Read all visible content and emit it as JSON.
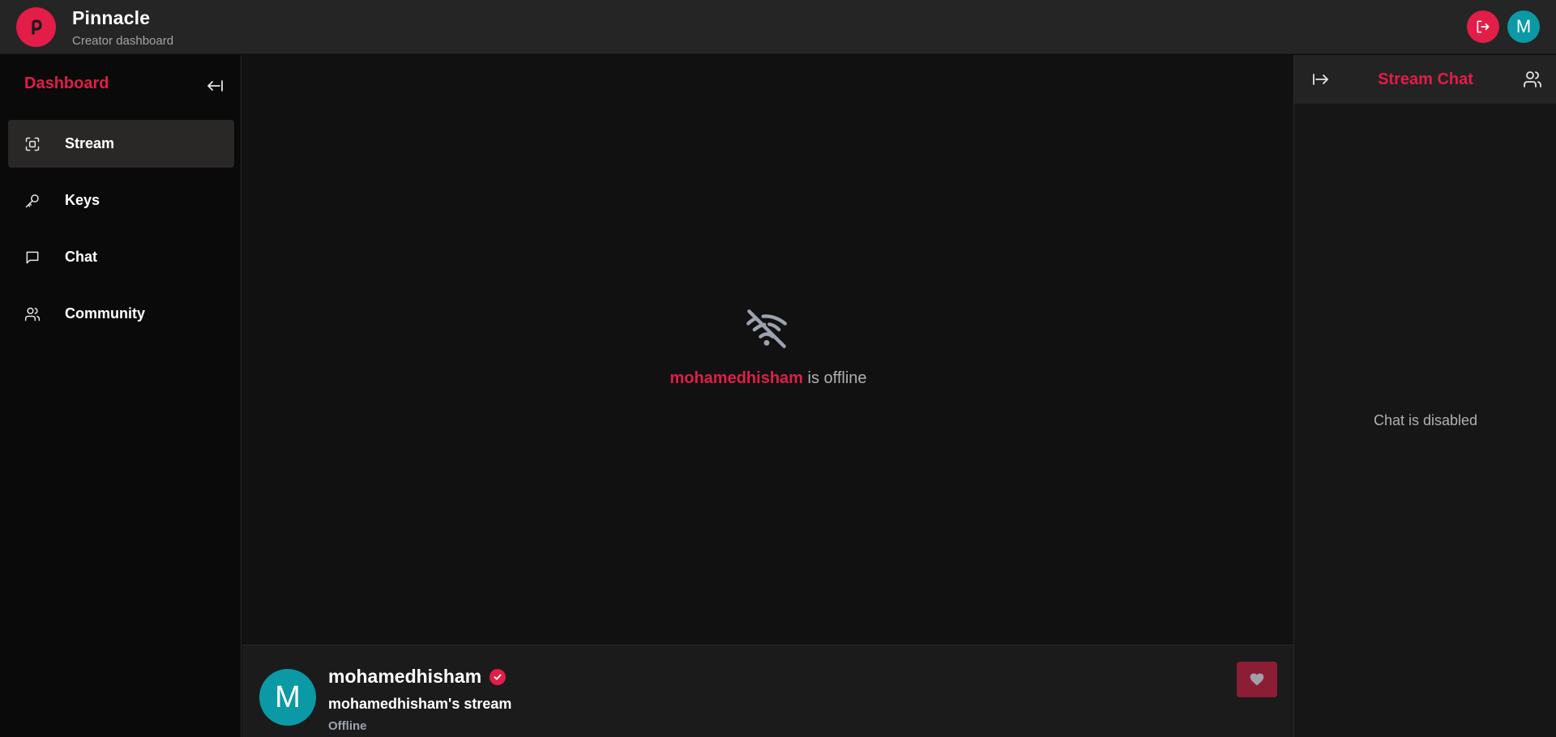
{
  "header": {
    "logo_letter": "P",
    "app_title": "Pinnacle",
    "app_subtitle": "Creator dashboard",
    "user_initial": "M",
    "icons": {
      "logo": "pinnacle-logo-icon",
      "logout": "logout-icon"
    }
  },
  "sidebar": {
    "title": "Dashboard",
    "collapse_icon": "collapse-left-icon",
    "items": [
      {
        "label": "Stream",
        "icon": "stream-icon",
        "active": true
      },
      {
        "label": "Keys",
        "icon": "key-icon",
        "active": false
      },
      {
        "label": "Chat",
        "icon": "chat-icon",
        "active": false
      },
      {
        "label": "Community",
        "icon": "users-icon",
        "active": false
      }
    ]
  },
  "player": {
    "username": "mohamedhisham",
    "status_suffix": " is offline",
    "icon": "wifi-off-icon"
  },
  "stream_info": {
    "avatar_initial": "M",
    "username": "mohamedhisham",
    "stream_name": "mohamedhisham's stream",
    "status": "Offline",
    "follow_icon": "heart-icon"
  },
  "chat": {
    "title": "Stream Chat",
    "disabled_text": "Chat is disabled",
    "expand_icon": "expand-right-icon",
    "community_icon": "users-icon"
  },
  "colors": {
    "accent": "#e11d48",
    "avatar": "#0b99a5",
    "follow_button": "#8b1e35"
  }
}
